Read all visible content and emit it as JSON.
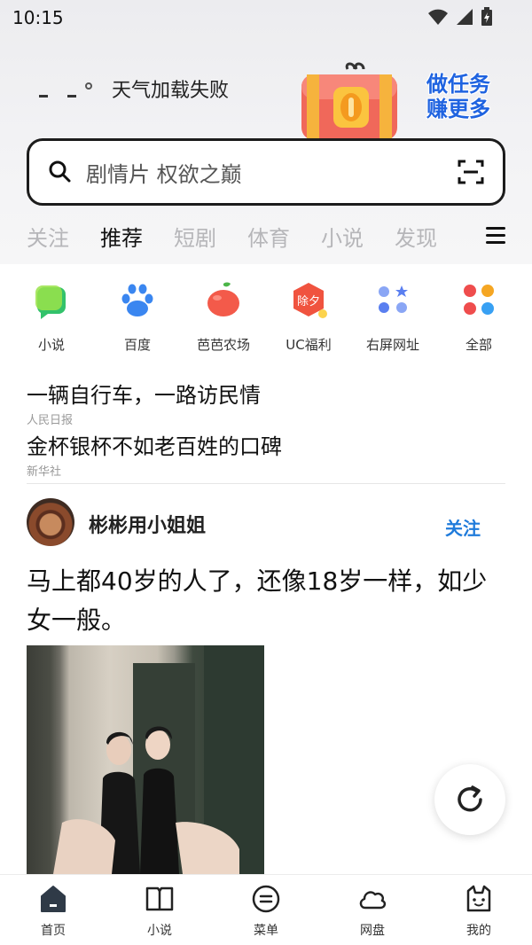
{
  "status_bar": {
    "time": "10:15"
  },
  "weather": {
    "text": "天气加载失败"
  },
  "promo": {
    "line1": "做任务",
    "line2": "赚更多"
  },
  "search": {
    "placeholder": "剧情片 权欲之巅"
  },
  "tabs": [
    {
      "label": "关注",
      "active": false
    },
    {
      "label": "推荐",
      "active": true
    },
    {
      "label": "短剧",
      "active": false
    },
    {
      "label": "体育",
      "active": false
    },
    {
      "label": "小说",
      "active": false
    },
    {
      "label": "发现",
      "active": false
    }
  ],
  "shortcuts": [
    {
      "label": "小说",
      "icon": "novel-icon"
    },
    {
      "label": "百度",
      "icon": "baidu-paw-icon"
    },
    {
      "label": "芭芭农场",
      "icon": "farm-apple-icon"
    },
    {
      "label": "UC福利",
      "icon": "uc-welfare-icon",
      "badge": "除夕"
    },
    {
      "label": "右屏网址",
      "icon": "sites-icon"
    },
    {
      "label": "全部",
      "icon": "all-apps-icon"
    }
  ],
  "headlines": [
    {
      "title": "一辆自行车，一路访民情",
      "source": "人民日报"
    },
    {
      "title": "金杯银杯不如老百姓的口碑",
      "source": "新华社"
    }
  ],
  "post": {
    "author": "彬彬用小姐姐",
    "follow_label": "关注",
    "text": "马上都40岁的人了，还像18岁一样，如少女一般。"
  },
  "bottom_nav": [
    {
      "label": "首页",
      "icon": "home-icon"
    },
    {
      "label": "小说",
      "icon": "book-icon"
    },
    {
      "label": "菜单",
      "icon": "menu-icon"
    },
    {
      "label": "网盘",
      "icon": "cloud-icon"
    },
    {
      "label": "我的",
      "icon": "profile-icon"
    }
  ],
  "colors": {
    "accent": "#1f7bdb",
    "tab_inactive": "#b6b6b9"
  }
}
